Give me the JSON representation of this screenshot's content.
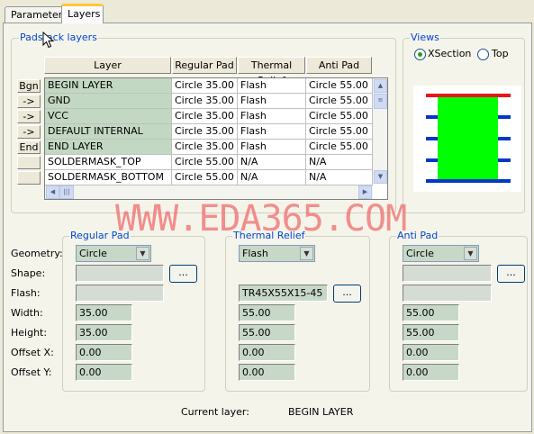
{
  "tabs": [
    "Parameters",
    "Layers"
  ],
  "padstack_group": "Padstack layers",
  "grid": {
    "columns": [
      "Layer",
      "Regular Pad",
      "Thermal Relief",
      "Anti Pad"
    ],
    "rows": [
      [
        "BEGIN LAYER",
        "Circle 35.00",
        "Flash",
        "Circle 55.00"
      ],
      [
        "GND",
        "Circle 35.00",
        "Flash",
        "Circle 55.00"
      ],
      [
        "VCC",
        "Circle 35.00",
        "Flash",
        "Circle 55.00"
      ],
      [
        "DEFAULT INTERNAL",
        "Circle 35.00",
        "Flash",
        "Circle 55.00"
      ],
      [
        "END LAYER",
        "Circle 35.00",
        "Flash",
        "Circle 55.00"
      ],
      [
        "SOLDERMASK_TOP",
        "Circle 55.00",
        "N/A",
        "N/A"
      ],
      [
        "SOLDERMASK_BOTTOM",
        "Circle 55.00",
        "N/A",
        "N/A"
      ]
    ],
    "row_buttons": [
      "Bgn",
      "->",
      "->",
      "->",
      "End",
      "",
      ""
    ]
  },
  "views": {
    "title": "Views",
    "options": [
      "XSection",
      "Top"
    ],
    "selected": "XSection",
    "colors": {
      "pad": "#00ff00",
      "top_layer": "#e8161b",
      "inner_layer": "#0038c8"
    }
  },
  "watermark": "WWW.EDA365.COM",
  "field_labels": [
    "Geometry:",
    "Shape:",
    "Flash:",
    "Width:",
    "Height:",
    "Offset X:",
    "Offset Y:"
  ],
  "regular_pad": {
    "title": "Regular Pad",
    "geometry": "Circle",
    "shape": "",
    "flash": "",
    "width": "35.00",
    "height": "35.00",
    "offset_x": "0.00",
    "offset_y": "0.00"
  },
  "thermal_relief": {
    "title": "Thermal Relief",
    "geometry": "Flash",
    "flash": "TR45X55X15-45",
    "width": "55.00",
    "height": "55.00",
    "offset_x": "0.00",
    "offset_y": "0.00"
  },
  "anti_pad": {
    "title": "Anti Pad",
    "geometry": "Circle",
    "shape": "",
    "flash": "",
    "width": "55.00",
    "height": "55.00",
    "offset_x": "0.00",
    "offset_y": "0.00"
  },
  "browse_label": "...",
  "current_layer": {
    "label": "Current layer:",
    "value": "BEGIN LAYER"
  }
}
